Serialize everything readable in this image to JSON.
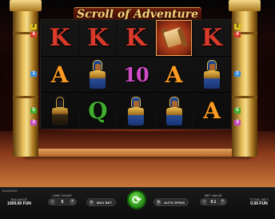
{
  "game": {
    "title": "Scroll of Adventure",
    "provider_logo": "BGAMING"
  },
  "reels": [
    [
      "K",
      "A",
      "anubis"
    ],
    [
      "K",
      "pharaoh-queen",
      "Q"
    ],
    [
      "K",
      "10",
      "pharaoh-queen"
    ],
    [
      "scroll",
      "A",
      "pharaoh-queen"
    ],
    [
      "K",
      "pharaoh-queen",
      "A"
    ]
  ],
  "paylines": {
    "left": [
      "2",
      "4",
      "1",
      "5",
      "3"
    ],
    "right": [
      "2",
      "4",
      "1",
      "5",
      "3"
    ]
  },
  "footer": {
    "balance_label": "BALANCE",
    "balance_value": "1000.00 FUN",
    "line_count_label": "LINE COUNT",
    "line_count_value": "5",
    "max_bet_label": "MAX BET",
    "auto_spins_label": "AUTO SPINS",
    "bet_value_label": "BET VALUE",
    "bet_value": "0.1",
    "total_bet_label": "TOTAL BET",
    "total_bet_value": "0.50 FUN"
  },
  "colors": {
    "spin_button": "#2f9a1c",
    "gold": "#e7c05a",
    "background": "#6b1b10"
  }
}
